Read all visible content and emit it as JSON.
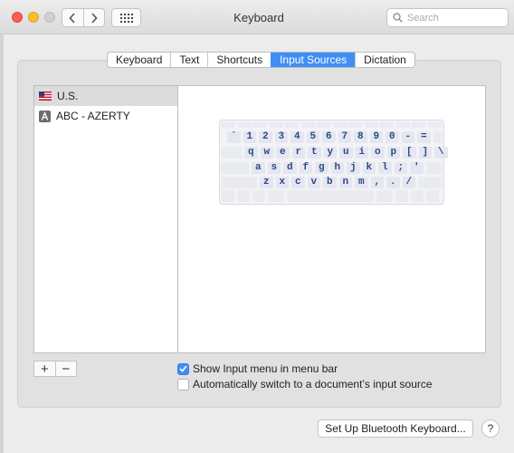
{
  "window": {
    "title": "Keyboard",
    "search_placeholder": "Search"
  },
  "tabs": [
    {
      "label": "Keyboard",
      "active": false
    },
    {
      "label": "Text",
      "active": false
    },
    {
      "label": "Shortcuts",
      "active": false
    },
    {
      "label": "Input Sources",
      "active": true
    },
    {
      "label": "Dictation",
      "active": false
    }
  ],
  "sources": [
    {
      "label": "U.S.",
      "icon": "us-flag-icon",
      "selected": true
    },
    {
      "label": "ABC - AZERTY",
      "icon": "letter-a-icon",
      "selected": false
    }
  ],
  "keyboard_preview": {
    "rows": [
      [
        "`",
        "1",
        "2",
        "3",
        "4",
        "5",
        "6",
        "7",
        "8",
        "9",
        "0",
        "-",
        "="
      ],
      [
        "q",
        "w",
        "e",
        "r",
        "t",
        "y",
        "u",
        "i",
        "o",
        "p",
        "[",
        "]",
        "\\"
      ],
      [
        "a",
        "s",
        "d",
        "f",
        "g",
        "h",
        "j",
        "k",
        "l",
        ";",
        "'"
      ],
      [
        "z",
        "x",
        "c",
        "v",
        "b",
        "n",
        "m",
        ",",
        ".",
        "/"
      ]
    ]
  },
  "list_controls": {
    "add_label": "+",
    "remove_label": "−"
  },
  "options": {
    "show_input_menu_label": "Show Input menu in menu bar",
    "show_input_menu_checked": true,
    "auto_switch_label": "Automatically switch to a document’s input source",
    "auto_switch_checked": false
  },
  "footer": {
    "bluetooth_button_label": "Set Up Bluetooth Keyboard...",
    "help_label": "?"
  },
  "colors": {
    "accent": "#3f8ef5",
    "key_text": "#2c4a8a"
  }
}
